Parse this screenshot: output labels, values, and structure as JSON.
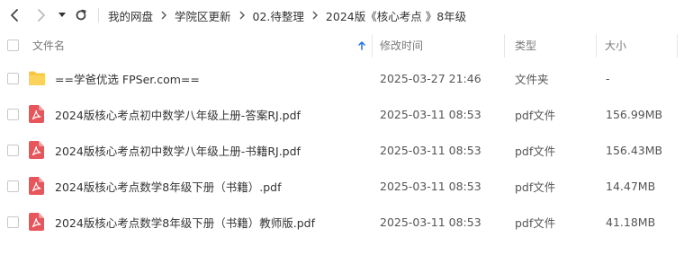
{
  "nav": {
    "back_icon": "chevron-left-icon",
    "forward_icon": "chevron-right-icon",
    "history_icon": "caret-down-icon",
    "refresh_icon": "refresh-icon",
    "breadcrumbs": [
      "我的网盘",
      "学院区更新",
      "02.待整理",
      "2024版《核心考点 》8年级"
    ]
  },
  "columns": {
    "name": "文件名",
    "modified": "修改时间",
    "type": "类型",
    "size": "大小",
    "sort_icon": "arrow-up-icon"
  },
  "colors": {
    "accent": "#1a73e8",
    "folder": "#f7c744",
    "pdf": "#e8555a"
  },
  "files": [
    {
      "name": "==学爸优选 FPSer.com==",
      "modified": "2025-03-27 21:46",
      "type": "文件夹",
      "size": "-",
      "icon": "folder-icon"
    },
    {
      "name": "2024版核心考点初中数学八年级上册-答案RJ.pdf",
      "modified": "2025-03-11 08:53",
      "type": "pdf文件",
      "size": "156.99MB",
      "icon": "pdf-icon"
    },
    {
      "name": "2024版核心考点初中数学八年级上册-书籍RJ.pdf",
      "modified": "2025-03-11 08:53",
      "type": "pdf文件",
      "size": "156.43MB",
      "icon": "pdf-icon"
    },
    {
      "name": "2024版核心考点数学8年级下册（书籍）.pdf",
      "modified": "2025-03-11 08:53",
      "type": "pdf文件",
      "size": "14.47MB",
      "icon": "pdf-icon"
    },
    {
      "name": "2024版核心考点数学8年级下册（书籍）教师版.pdf",
      "modified": "2025-03-11 08:53",
      "type": "pdf文件",
      "size": "41.18MB",
      "icon": "pdf-icon"
    }
  ]
}
